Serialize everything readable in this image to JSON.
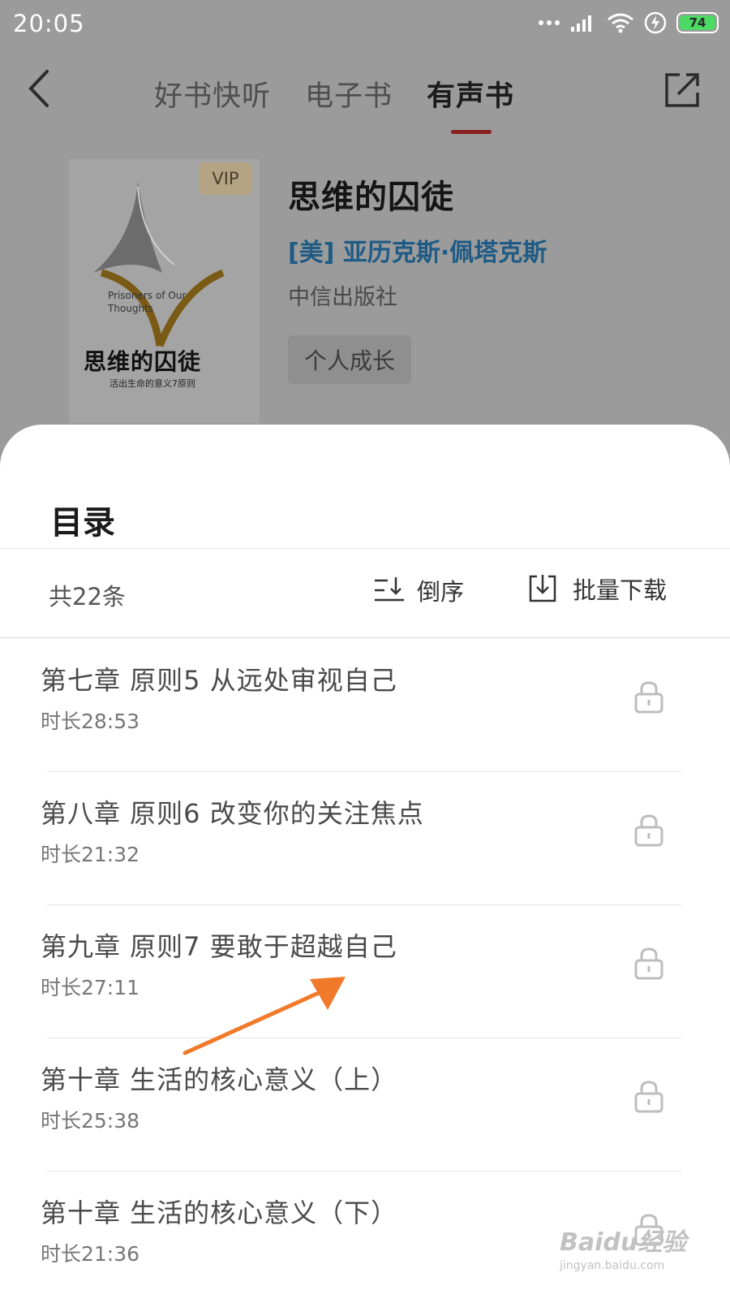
{
  "status": {
    "time": "20:05",
    "battery": "74"
  },
  "nav": {
    "tabs": [
      {
        "label": "好书快听"
      },
      {
        "label": "电子书"
      },
      {
        "label": "有声书"
      }
    ]
  },
  "book": {
    "cover_vip": "VIP",
    "cover_title": "思维的囚徒",
    "cover_subtitle": "活出生命的意义7原则",
    "cover_en_title": "Prisoners of Our Thoughts",
    "title": "思维的囚徒",
    "author": "[美] 亚历克斯·佩塔克斯",
    "publisher": "中信出版社",
    "tag": "个人成长"
  },
  "catalog": {
    "title": "目录",
    "count": "共22条",
    "sort_label": "倒序",
    "download_label": "批量下载",
    "items": [
      {
        "title": "第七章 原则5 从远处审视自己",
        "duration": "时长28:53"
      },
      {
        "title": "第八章 原则6 改变你的关注焦点",
        "duration": "时长21:32"
      },
      {
        "title": "第九章 原则7 要敢于超越自己",
        "duration": "时长27:11"
      },
      {
        "title": "第十章 生活的核心意义（上）",
        "duration": "时长25:38"
      },
      {
        "title": "第十章 生活的核心意义（下）",
        "duration": "时长21:36"
      }
    ]
  },
  "watermark": {
    "main": "Baidu经验",
    "sub": "jingyan.baidu.com"
  },
  "colors": {
    "accent": "#c8323a",
    "author": "#2a7cbf",
    "annotation_arrow": "#f07a2a"
  }
}
